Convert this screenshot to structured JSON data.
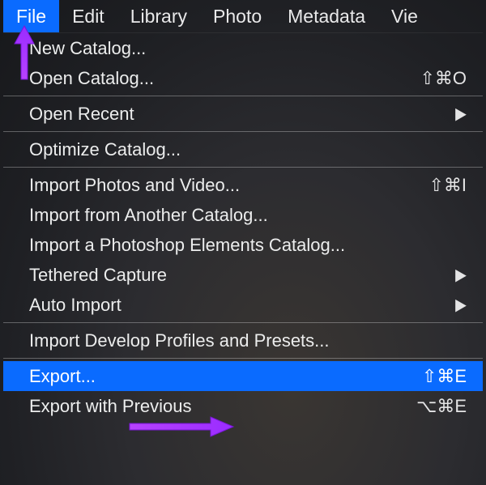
{
  "menubar": {
    "items": [
      {
        "label": "File",
        "active": true
      },
      {
        "label": "Edit"
      },
      {
        "label": "Library"
      },
      {
        "label": "Photo"
      },
      {
        "label": "Metadata"
      },
      {
        "label": "Vie"
      }
    ]
  },
  "dropdown": {
    "groups": [
      [
        {
          "label": "New Catalog...",
          "shortcut": ""
        },
        {
          "label": "Open Catalog...",
          "shortcut": "⇧⌘O"
        }
      ],
      [
        {
          "label": "Open Recent",
          "submenu": true
        }
      ],
      [
        {
          "label": "Optimize Catalog..."
        }
      ],
      [
        {
          "label": "Import Photos and Video...",
          "shortcut": "⇧⌘I"
        },
        {
          "label": "Import from Another Catalog..."
        },
        {
          "label": "Import a Photoshop Elements Catalog..."
        },
        {
          "label": "Tethered Capture",
          "submenu": true
        },
        {
          "label": "Auto Import",
          "submenu": true
        }
      ],
      [
        {
          "label": "Import Develop Profiles and Presets..."
        }
      ],
      [
        {
          "label": "Export...",
          "shortcut": "⇧⌘E",
          "highlight": true
        },
        {
          "label": "Export with Previous",
          "shortcut": "⌥⌘E"
        }
      ]
    ]
  },
  "annotations": {
    "arrow_up_color": "#9a2cff",
    "arrow_right_color": "#a22dff"
  }
}
